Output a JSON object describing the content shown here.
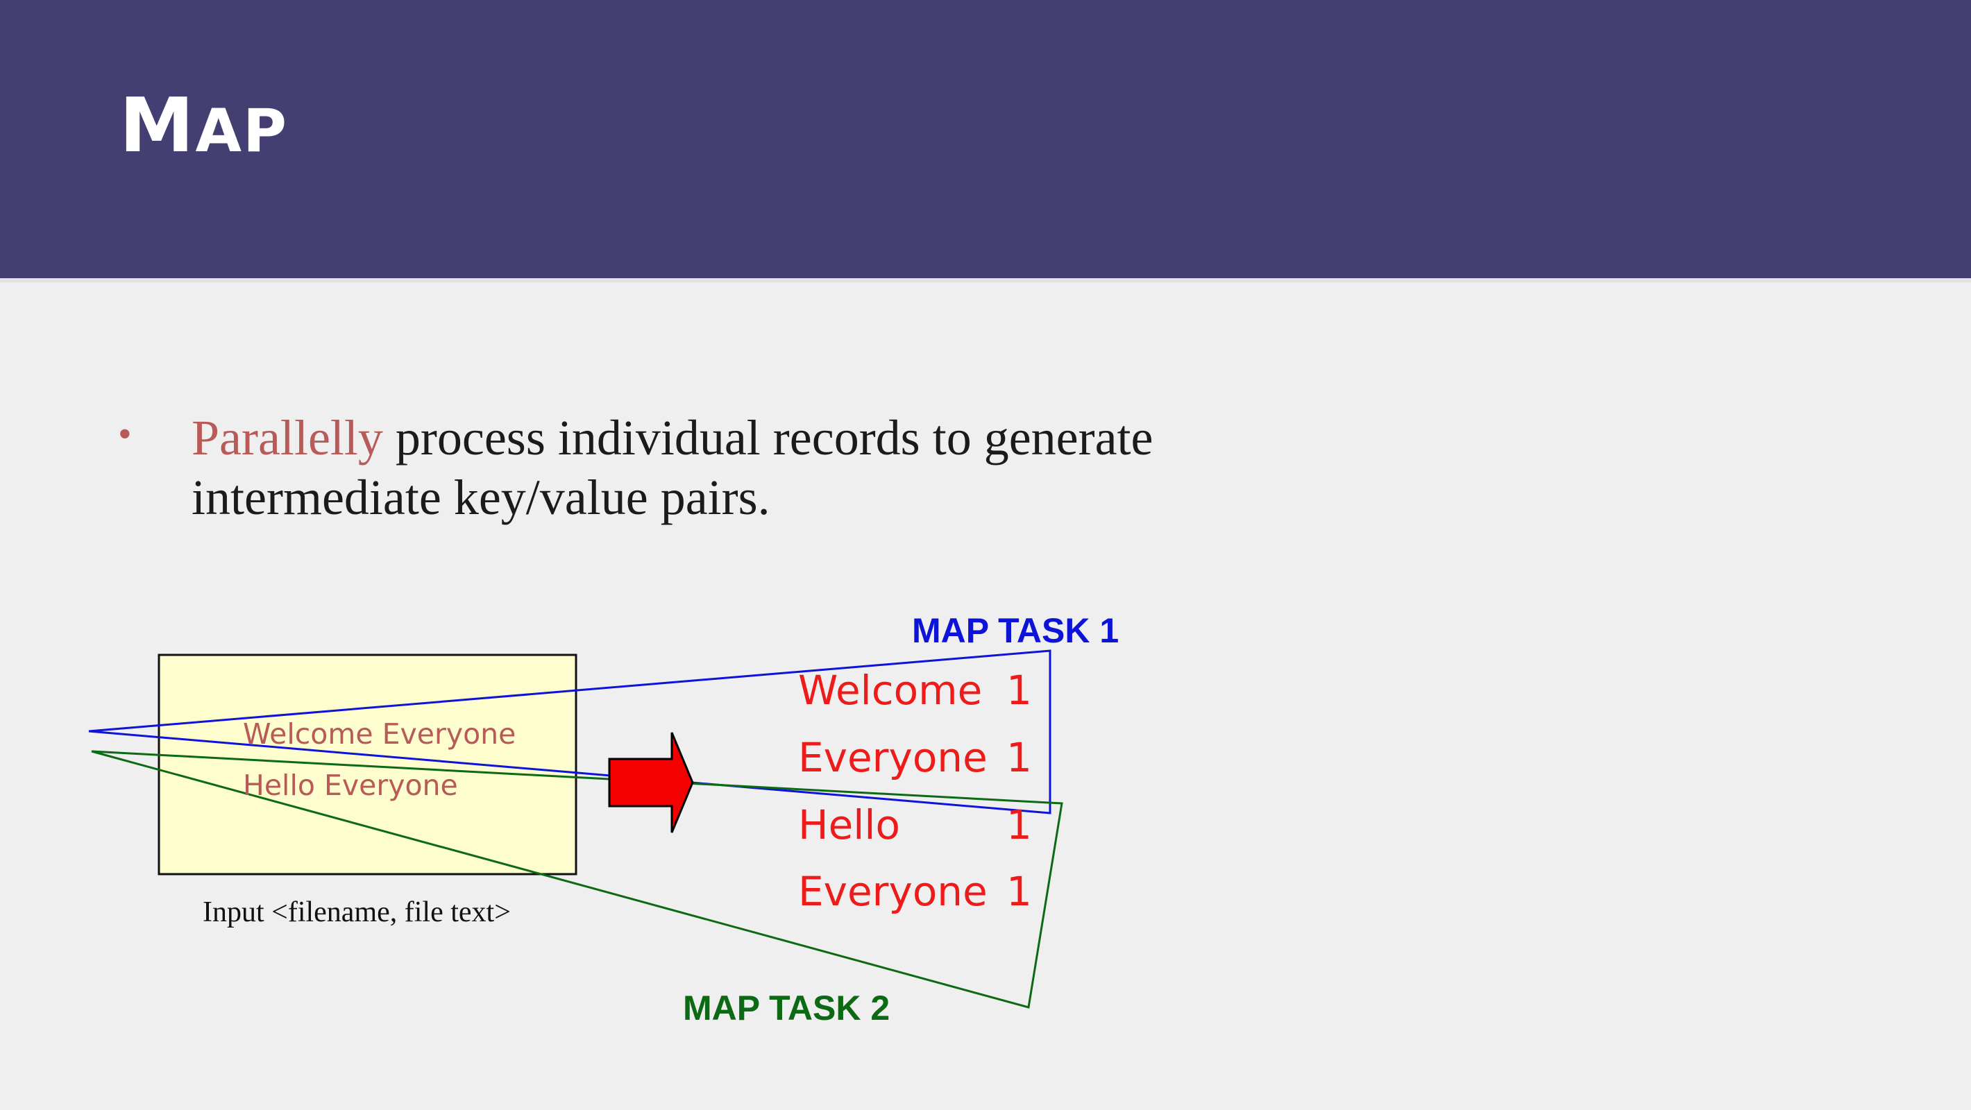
{
  "slide": {
    "title": "Map",
    "bullet": {
      "marker": "•",
      "highlight": "Parallelly",
      "text": " process individual records to generate intermediate key/value pairs."
    }
  },
  "diagram": {
    "input_lines": [
      "Welcome Everyone",
      "Hello Everyone"
    ],
    "input_caption": "Input <filename, file text>",
    "task1_label": "MAP TASK 1",
    "task2_label": "MAP TASK 2",
    "outputs": [
      {
        "key": "Welcome",
        "value": "1"
      },
      {
        "key": "Everyone",
        "value": "1"
      },
      {
        "key": "Hello",
        "value": "1"
      },
      {
        "key": "Everyone",
        "value": "1"
      }
    ],
    "colors": {
      "header": "#433f72",
      "highlight": "#b85a58",
      "task1": "#0d14d8",
      "task2": "#0b6a13",
      "output": "#ee1b1b",
      "input_box": "#fdfdcd",
      "arrow": "#f40000"
    }
  }
}
